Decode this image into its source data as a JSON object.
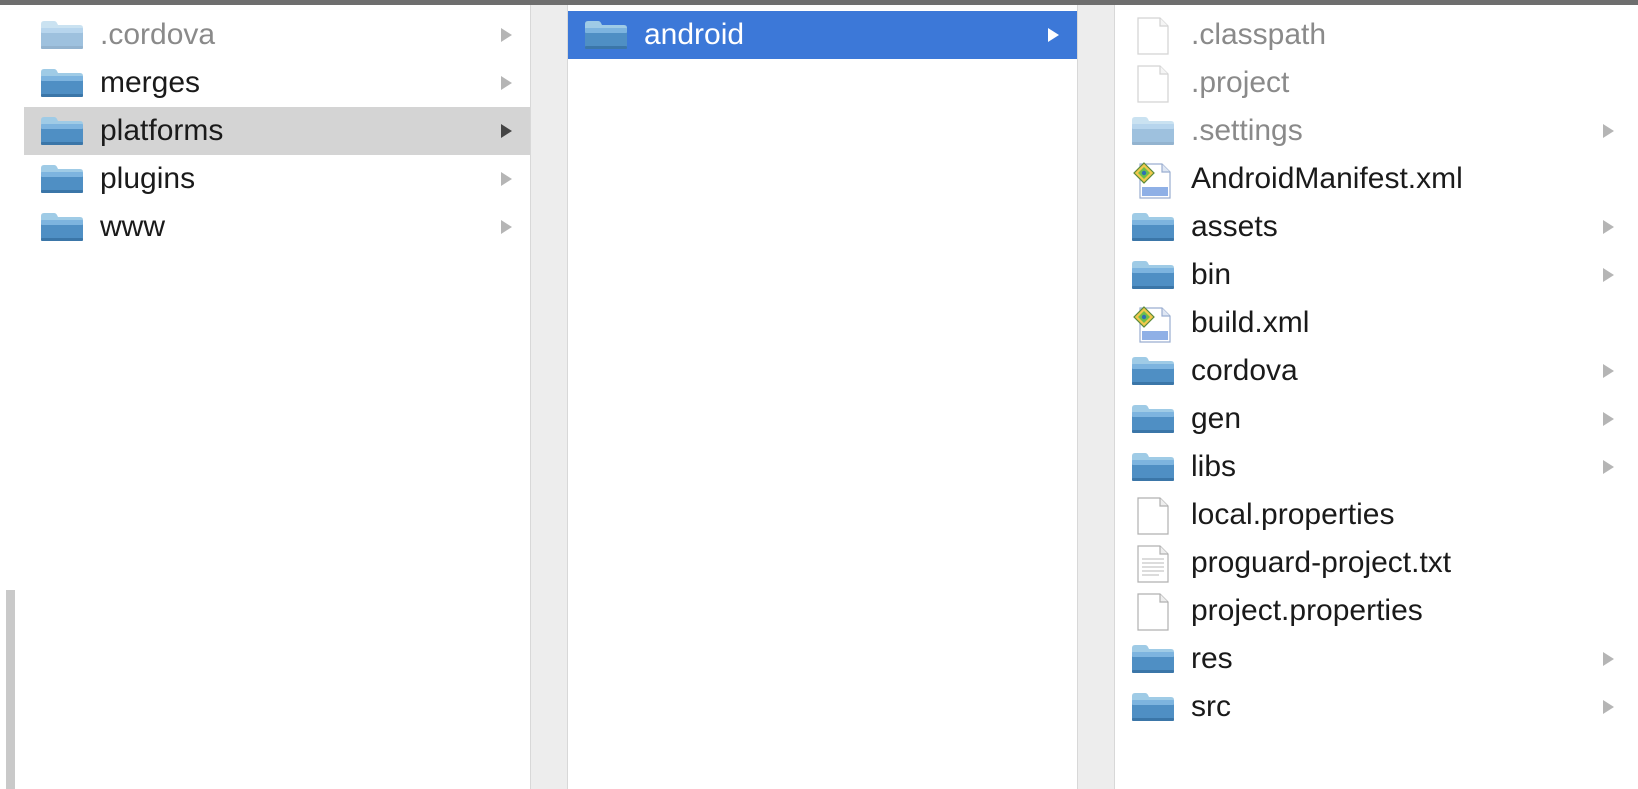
{
  "colors": {
    "selection": "#3c78d8",
    "inactive_selection": "#d4d4d4",
    "folder_top": "#9fcbe6",
    "folder_body": "#4f8fc4"
  },
  "columns": [
    {
      "items": [
        {
          "label": ".cordova",
          "icon": "folder-icon",
          "type": "folder",
          "hidden": true,
          "has_children": true
        },
        {
          "label": "merges",
          "icon": "folder-icon",
          "type": "folder",
          "has_children": true
        },
        {
          "label": "platforms",
          "icon": "folder-icon",
          "type": "folder",
          "has_children": true,
          "state": "inactive-selected"
        },
        {
          "label": "plugins",
          "icon": "folder-icon",
          "type": "folder",
          "has_children": true
        },
        {
          "label": "www",
          "icon": "folder-icon",
          "type": "folder",
          "has_children": true
        }
      ]
    },
    {
      "items": [
        {
          "label": "android",
          "icon": "folder-icon",
          "type": "folder",
          "has_children": true,
          "state": "selected"
        }
      ]
    },
    {
      "items": [
        {
          "label": ".classpath",
          "icon": "document-icon",
          "type": "file",
          "hidden": true
        },
        {
          "label": ".project",
          "icon": "document-icon",
          "type": "file",
          "hidden": true
        },
        {
          "label": ".settings",
          "icon": "folder-icon",
          "type": "folder",
          "hidden": true,
          "has_children": true
        },
        {
          "label": "AndroidManifest.xml",
          "icon": "xml-file-icon",
          "type": "xml"
        },
        {
          "label": "assets",
          "icon": "folder-icon",
          "type": "folder",
          "has_children": true
        },
        {
          "label": "bin",
          "icon": "folder-icon",
          "type": "folder",
          "has_children": true
        },
        {
          "label": "build.xml",
          "icon": "xml-file-icon",
          "type": "xml"
        },
        {
          "label": "cordova",
          "icon": "folder-icon",
          "type": "folder",
          "has_children": true
        },
        {
          "label": "gen",
          "icon": "folder-icon",
          "type": "folder",
          "has_children": true
        },
        {
          "label": "libs",
          "icon": "folder-icon",
          "type": "folder",
          "has_children": true
        },
        {
          "label": "local.properties",
          "icon": "document-icon",
          "type": "file"
        },
        {
          "label": "proguard-project.txt",
          "icon": "text-document-icon",
          "type": "text"
        },
        {
          "label": "project.properties",
          "icon": "document-icon",
          "type": "file"
        },
        {
          "label": "res",
          "icon": "folder-icon",
          "type": "folder",
          "has_children": true
        },
        {
          "label": "src",
          "icon": "folder-icon",
          "type": "folder",
          "has_children": true
        }
      ]
    }
  ]
}
